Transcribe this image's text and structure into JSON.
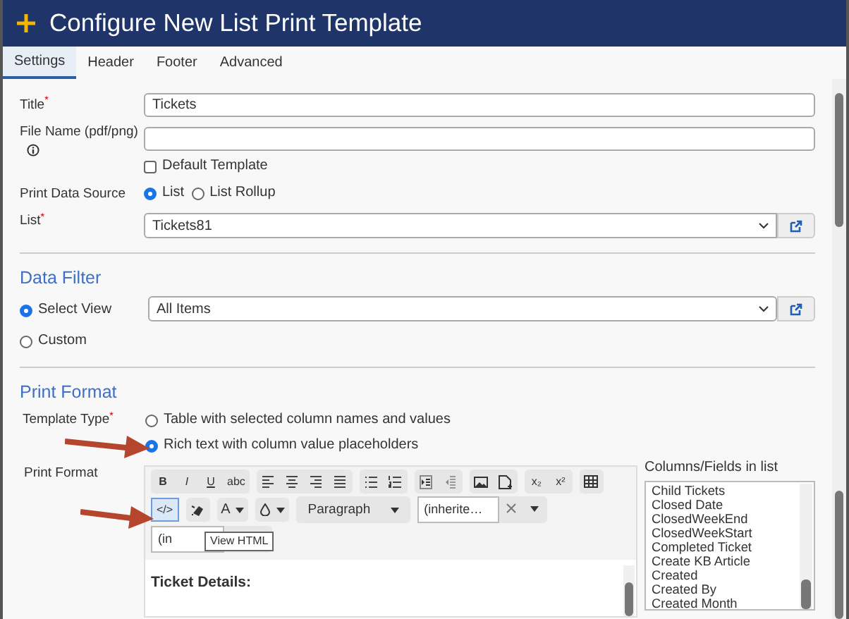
{
  "dialog": {
    "title": "Configure New List Print Template"
  },
  "tabs": [
    {
      "label": "Settings",
      "selected": true
    },
    {
      "label": "Header",
      "selected": false
    },
    {
      "label": "Footer",
      "selected": false
    },
    {
      "label": "Advanced",
      "selected": false
    }
  ],
  "settings": {
    "title_field": {
      "label": "Title",
      "required_mark": "*",
      "value": "Tickets"
    },
    "file_name_field": {
      "label": "File Name (pdf/png)"
    },
    "default_template": {
      "label": "Default Template",
      "checked": false
    },
    "data_source": {
      "label": "Print Data Source",
      "options": [
        {
          "label": "List",
          "selected": true
        },
        {
          "label": "List Rollup",
          "selected": false
        }
      ]
    },
    "list": {
      "label": "List",
      "required_mark": "*",
      "value": "Tickets81"
    }
  },
  "data_filter": {
    "heading": "Data Filter",
    "options": [
      {
        "label": "Select View",
        "selected": true
      },
      {
        "label": "Custom",
        "selected": false
      }
    ],
    "view": "All Items"
  },
  "print_format": {
    "heading": "Print Format",
    "template_type": {
      "label": "Template Type",
      "required_mark": "*",
      "options": [
        {
          "label": "Table with selected column names and values",
          "selected": false
        },
        {
          "label": "Rich text with column value placeholders",
          "selected": true
        }
      ]
    },
    "editor": {
      "label": "Print Format",
      "toolbar": [
        [
          [
            {
              "kind": "text",
              "label": "B",
              "active": false
            },
            {
              "kind": "text",
              "label": "I",
              "active": false
            },
            {
              "kind": "text",
              "label": "U",
              "active": false
            },
            {
              "kind": "text",
              "label": "abc",
              "active": false
            }
          ],
          [
            {
              "kind": "alignleft",
              "active": false
            },
            {
              "kind": "aligncenter",
              "active": false
            },
            {
              "kind": "alignright",
              "active": false
            },
            {
              "kind": "justify",
              "active": false
            }
          ],
          [
            {
              "kind": "bullets",
              "active": false
            },
            {
              "kind": "numbers",
              "active": false
            }
          ],
          [
            {
              "kind": "indent",
              "active": false
            },
            {
              "kind": "outdent",
              "active": false
            }
          ],
          [
            {
              "kind": "image",
              "active": false
            },
            {
              "kind": "file",
              "active": false
            }
          ],
          [
            {
              "kind": "text",
              "label": "x₂",
              "active": false
            },
            {
              "kind": "text",
              "label": "x²",
              "active": false
            }
          ],
          [
            {
              "kind": "table",
              "active": false
            }
          ]
        ],
        [
          [
            {
              "kind": "text",
              "label": "</>",
              "active": true
            }
          ],
          [
            {
              "kind": "eraser",
              "active": false
            }
          ],
          [
            {
              "kind": "textmenu",
              "label": "A",
              "active": false
            }
          ],
          [
            {
              "kind": "dropmenu",
              "active": false
            }
          ],
          [
            {
              "kind": "select",
              "label": "Paragraph",
              "active": false
            }
          ],
          [
            {
              "kind": "combo",
              "label": "(inherite…",
              "active": false
            }
          ]
        ],
        [
          [
            {
              "kind": "combo",
              "label": "(in",
              "active": false
            }
          ]
        ]
      ],
      "tooltip": "View HTML",
      "content": "Ticket Details:"
    },
    "columns": {
      "label": "Columns/Fields in list",
      "items": [
        "Child Tickets",
        "Closed Date",
        "ClosedWeekEnd",
        "ClosedWeekStart",
        "Completed Ticket",
        "Create KB Article",
        "Created",
        "Created By",
        "Created Month"
      ]
    }
  }
}
